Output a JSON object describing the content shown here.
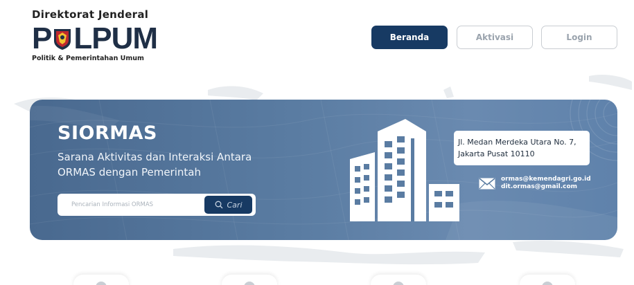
{
  "logo": {
    "top_text": "Direktorat Jenderal",
    "main_left": "P",
    "main_right": "LPUM",
    "sub_text": "Politik & Pemerintahan Umum"
  },
  "nav": {
    "beranda": "Beranda",
    "aktivasi": "Aktivasi",
    "login": "Login"
  },
  "hero": {
    "title": "SIORMAS",
    "subtitle": "Sarana Aktivitas dan Interaksi Antara ORMAS dengan Pemerintah",
    "search_placeholder": "Pencarian Informasi ORMAS",
    "search_button": "Cari",
    "address_line1": "Jl. Medan Merdeka Utara No. 7,",
    "address_line2": "Jakarta Pusat 10110",
    "email1": "ormas@kemendagri.go.id",
    "email2": "dit.ormas@gmail.com"
  },
  "colors": {
    "primary": "#173a63",
    "hero_bg": "#5a7ca2",
    "muted_text": "#9aa3ad"
  },
  "icons": [
    "building-icon",
    "mail-icon",
    "search-icon",
    "garuda-emblem-icon"
  ]
}
